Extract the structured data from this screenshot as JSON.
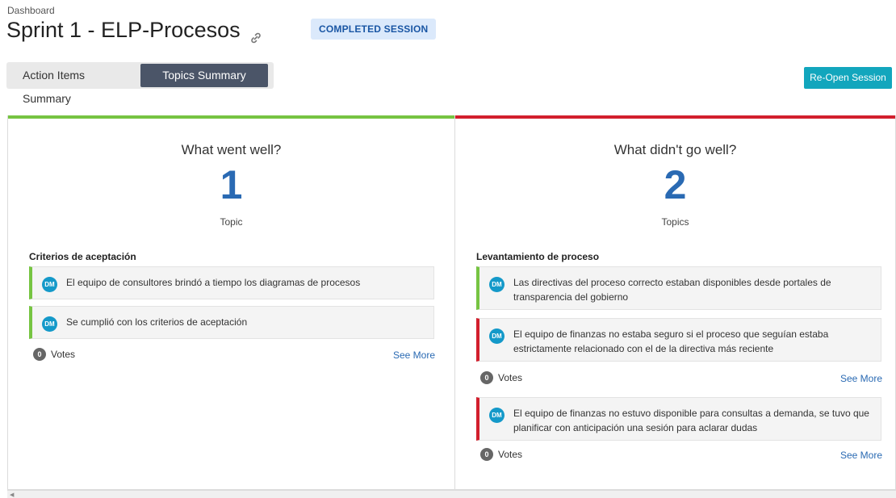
{
  "header": {
    "breadcrumb": "Dashboard",
    "title": "Sprint 1 - ELP-Procesos",
    "status_badge": "COMPLETED SESSION",
    "title_icon": "link-icon"
  },
  "tabs": [
    {
      "label": "Action Items Summary",
      "active": false
    },
    {
      "label": "Topics Summary",
      "active": true
    }
  ],
  "reopen_button": "Re-Open Session",
  "colors": {
    "well": "#76c442",
    "not_well": "#d21f2d",
    "accent": "#12a6bd",
    "count": "#2a6ab3"
  },
  "columns": {
    "well": {
      "title": "What went well?",
      "count": "1",
      "unit": "Topic",
      "group_title": "Criterios de aceptación",
      "cards": [
        {
          "avatar": "DM",
          "text": "El equipo de consultores brindó a tiempo los diagramas de procesos"
        },
        {
          "avatar": "DM",
          "text": "Se cumplió con los criterios de aceptación"
        }
      ],
      "votes": "0",
      "votes_label": "Votes",
      "see_more": "See More"
    },
    "not_well": {
      "title": "What didn't go well?",
      "count": "2",
      "unit": "Topics",
      "group_title": "Levantamiento de proceso",
      "cards": [
        {
          "avatar": "DM",
          "text": "Las directivas del proceso correcto estaban disponibles desde portales de transparencia del gobierno"
        },
        {
          "avatar": "DM",
          "text": "El equipo de finanzas no estaba seguro si el proceso que seguían estaba estrictamente relacionado con el de la directiva más reciente"
        },
        {
          "avatar": "DM",
          "text": "El equipo de finanzas no estuvo disponible para consultas a demanda, se tuvo que planificar con anticipación una sesión para aclarar dudas"
        }
      ],
      "votes_1": "0",
      "votes_2": "0",
      "votes_label": "Votes",
      "see_more": "See More"
    }
  }
}
